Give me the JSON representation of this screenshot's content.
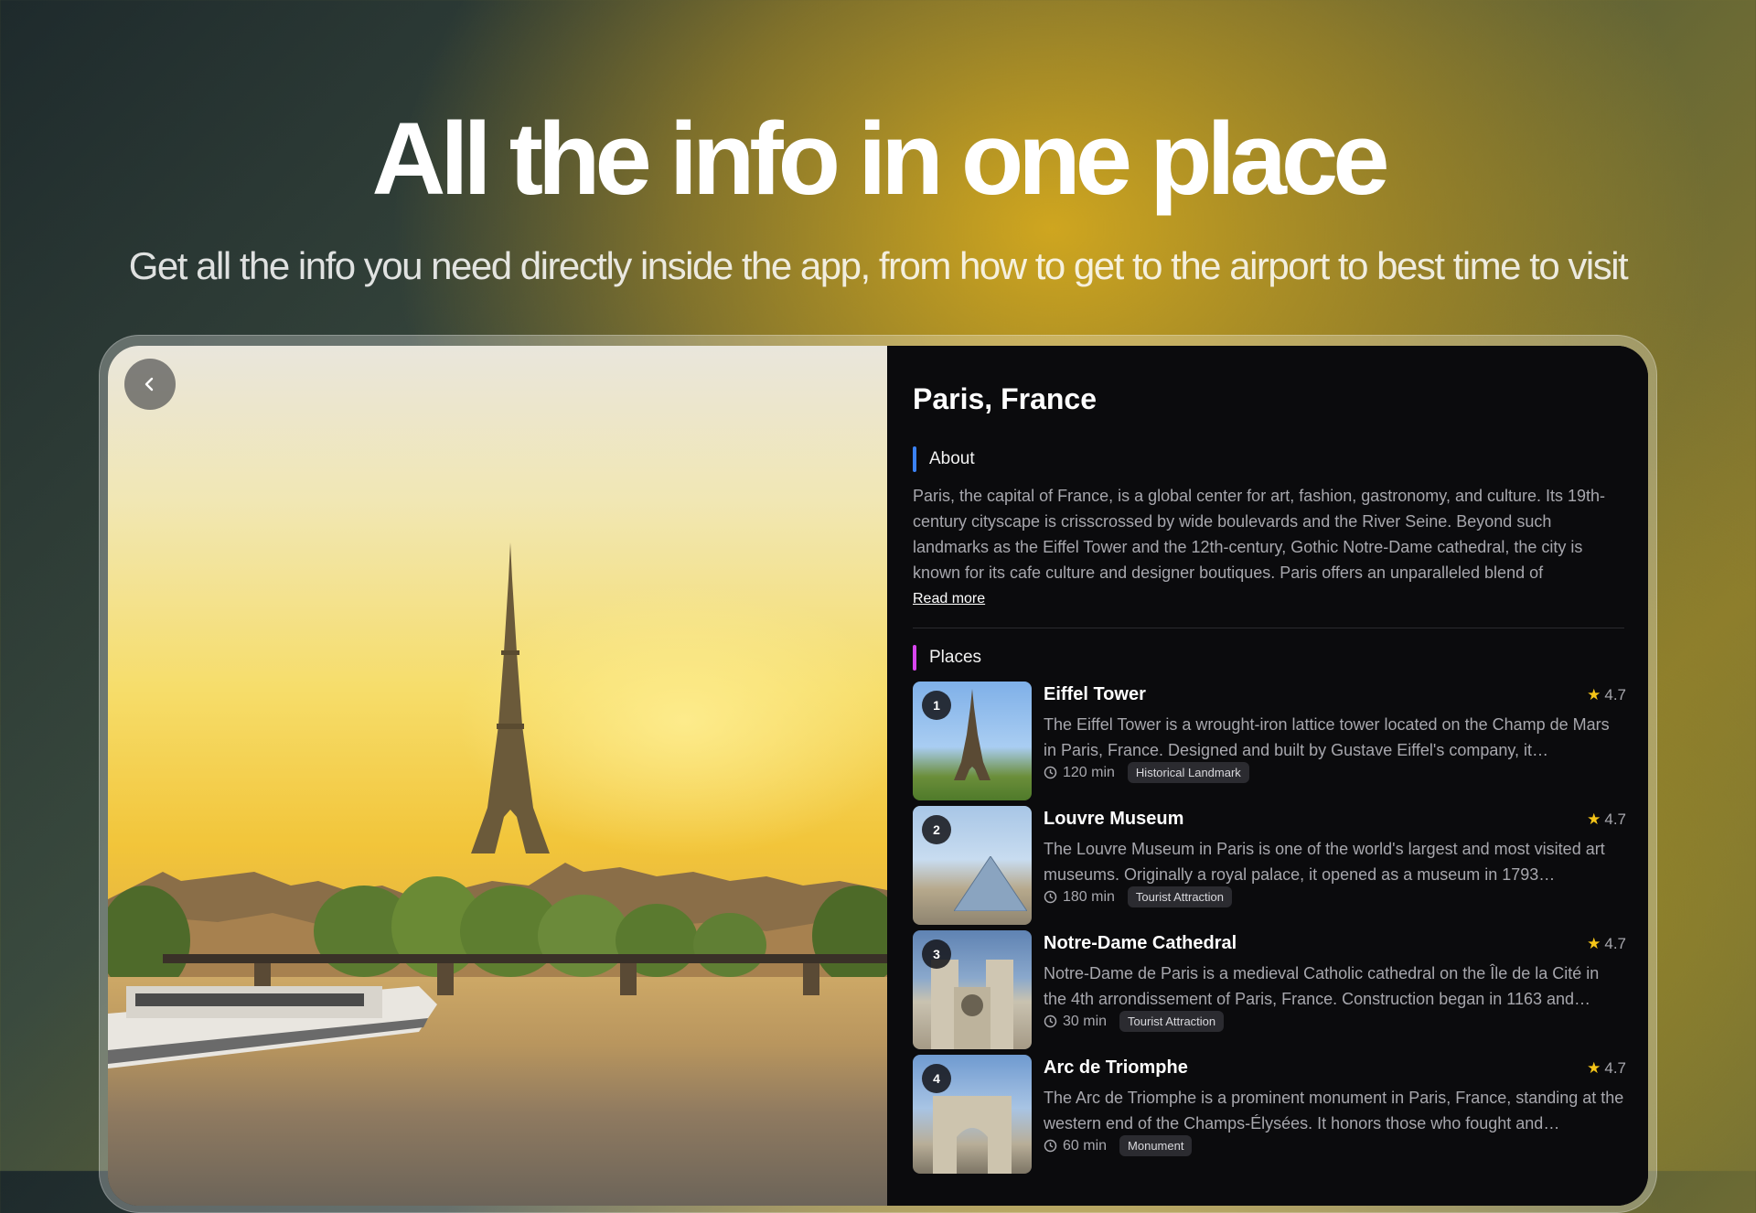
{
  "hero": {
    "title": "All the info in one place",
    "subtitle": "Get all the info you need directly inside the app, from how to get to the airport to best time to visit"
  },
  "colors": {
    "about_accent": "#3b82f6",
    "places_accent": "#d946ef",
    "star": "#f5c518",
    "panel_bg": "#0b0b0d"
  },
  "icons": {
    "back": "chevron-left-icon",
    "clock": "clock-icon",
    "star": "star-icon"
  },
  "city": {
    "name": "Paris, France",
    "about_label": "About",
    "about_text": "Paris, the capital of France, is a global center for art, fashion, gastronomy, and culture. Its 19th-century cityscape is crisscrossed by wide boulevards and the River Seine. Beyond such landmarks as the Eiffel Tower and the 12th-century, Gothic Notre-Dame cathedral, the city is known for its cafe culture and designer boutiques. Paris offers an unparalleled blend of",
    "read_more": "Read more",
    "places_label": "Places"
  },
  "places": [
    {
      "number": "1",
      "name": "Eiffel Tower",
      "rating": "4.7",
      "description": "The Eiffel Tower is a wrought-iron lattice tower located on the Champ de Mars in Paris, France. Designed and built by Gustave Eiffel's company, it…",
      "duration": "120 min",
      "tag": "Historical Landmark"
    },
    {
      "number": "2",
      "name": "Louvre Museum",
      "rating": "4.7",
      "description": "The Louvre Museum in Paris is one of the world's largest and most visited art museums. Originally a royal palace, it opened as a museum in 1793…",
      "duration": "180 min",
      "tag": "Tourist Attraction"
    },
    {
      "number": "3",
      "name": "Notre-Dame Cathedral",
      "rating": "4.7",
      "description": "Notre-Dame de Paris is a medieval Catholic cathedral on the Île de la Cité in the 4th arrondissement of Paris, France. Construction began in 1163 and…",
      "duration": "30 min",
      "tag": "Tourist Attraction"
    },
    {
      "number": "4",
      "name": "Arc de Triomphe",
      "rating": "4.7",
      "description": "The Arc de Triomphe is a prominent monument in Paris, France, standing at the western end of the Champs-Élysées. It honors those who fought and…",
      "duration": "60 min",
      "tag": "Monument"
    }
  ]
}
